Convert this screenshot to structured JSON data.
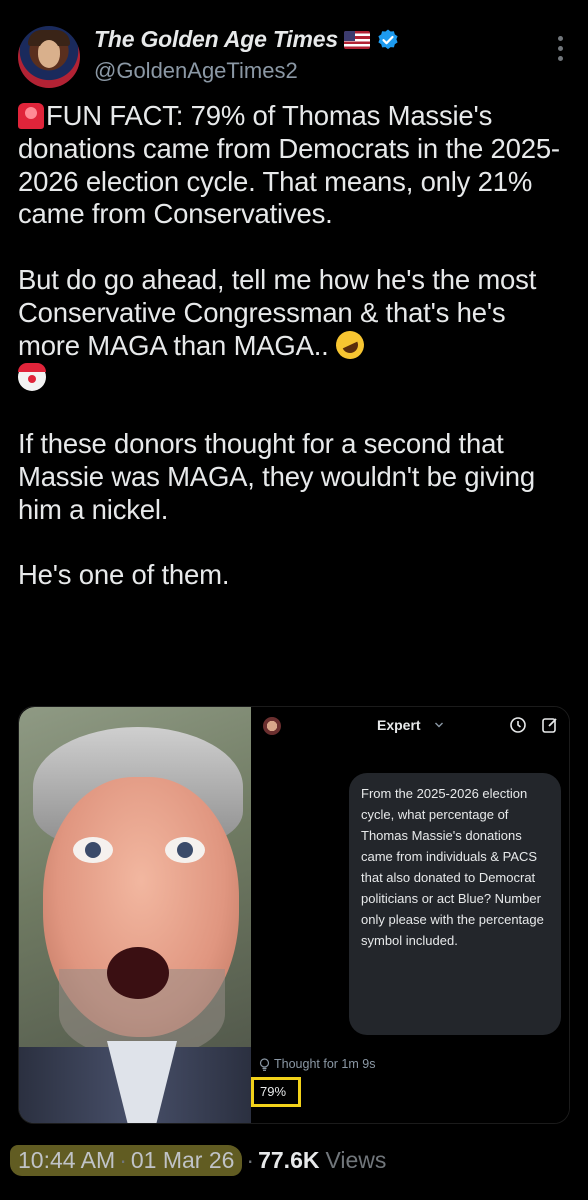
{
  "author": {
    "display_name": "The Golden Age Times",
    "handle": "@GoldenAgeTimes2"
  },
  "tweet": {
    "paragraph_1": "FUN FACT: 79% of Thomas Massie's donations came from Democrats in the 2025-2026 election cycle. That means, only 21% came from Conservatives.",
    "paragraph_2": "But do go ahead, tell me how he's the most Conservative Congressman & that's he's more MAGA than MAGA..",
    "paragraph_3": "If these donors thought for a second that Massie was MAGA, they wouldn't be giving him a nickel.",
    "paragraph_4": "He's one of them."
  },
  "media": {
    "chat_header": "Expert",
    "question": "From the 2025-2026 election cycle, what percentage of Thomas Massie's donations came from individuals & PACS that also donated to Democrat politicians or act Blue? Number only please with the percentage symbol included.",
    "thought_label": "Thought for 1m 9s",
    "answer": "79%"
  },
  "footer": {
    "time": "10:44 AM",
    "date": "01 Mar 26",
    "views": "77.6K",
    "views_label": "Views"
  },
  "colors": {
    "background": "#000000",
    "text": "#e7e9ea",
    "secondary": "#8b98a5",
    "verified": "#1d9bf0",
    "highlight_box": "#f2d21a"
  }
}
